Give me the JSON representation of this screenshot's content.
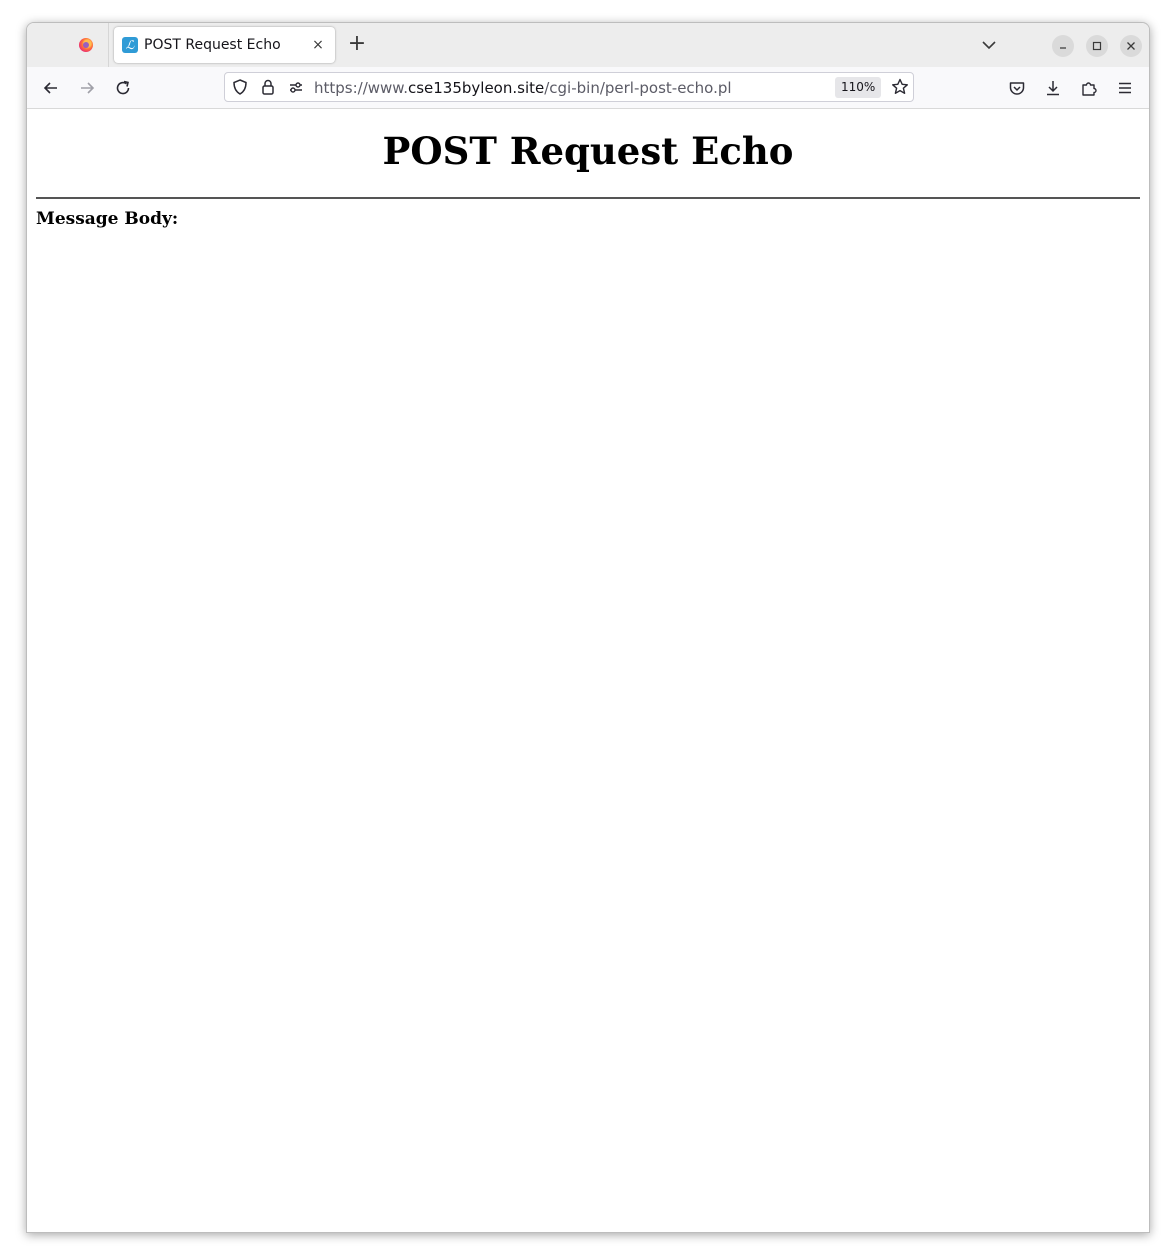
{
  "browser": {
    "tab": {
      "title": "POST Request Echo",
      "close_glyph": "×",
      "favicon_glyph": "ℒ",
      "favicon_icon": "site-favicon-icon"
    },
    "new_tab_glyph": "+",
    "url": {
      "scheme_prefix": "https://www.",
      "host": "cse135byleon.site",
      "path": "/cgi-bin/perl-post-echo.pl"
    },
    "zoom": "110%",
    "icons": {
      "back": "back-arrow-icon",
      "forward": "forward-arrow-icon",
      "reload": "reload-icon",
      "shield": "tracking-protection-shield-icon",
      "lock": "lock-icon",
      "permissions": "permissions-icon",
      "bookmark": "star-icon",
      "pocket": "pocket-icon",
      "downloads": "download-icon",
      "extensions": "extensions-puzzle-icon",
      "menu": "hamburger-menu-icon",
      "tab_list": "chevron-down-icon",
      "minimize": "minimize-icon",
      "maximize": "maximize-icon",
      "close_window": "close-icon"
    },
    "colors": {
      "tabstrip": "#ededed",
      "navbar": "#f9f9fb",
      "favicon": "#2f9bd6"
    }
  },
  "page": {
    "title": "POST Request Echo",
    "message_body_label": "Message Body:",
    "message_body": ""
  }
}
